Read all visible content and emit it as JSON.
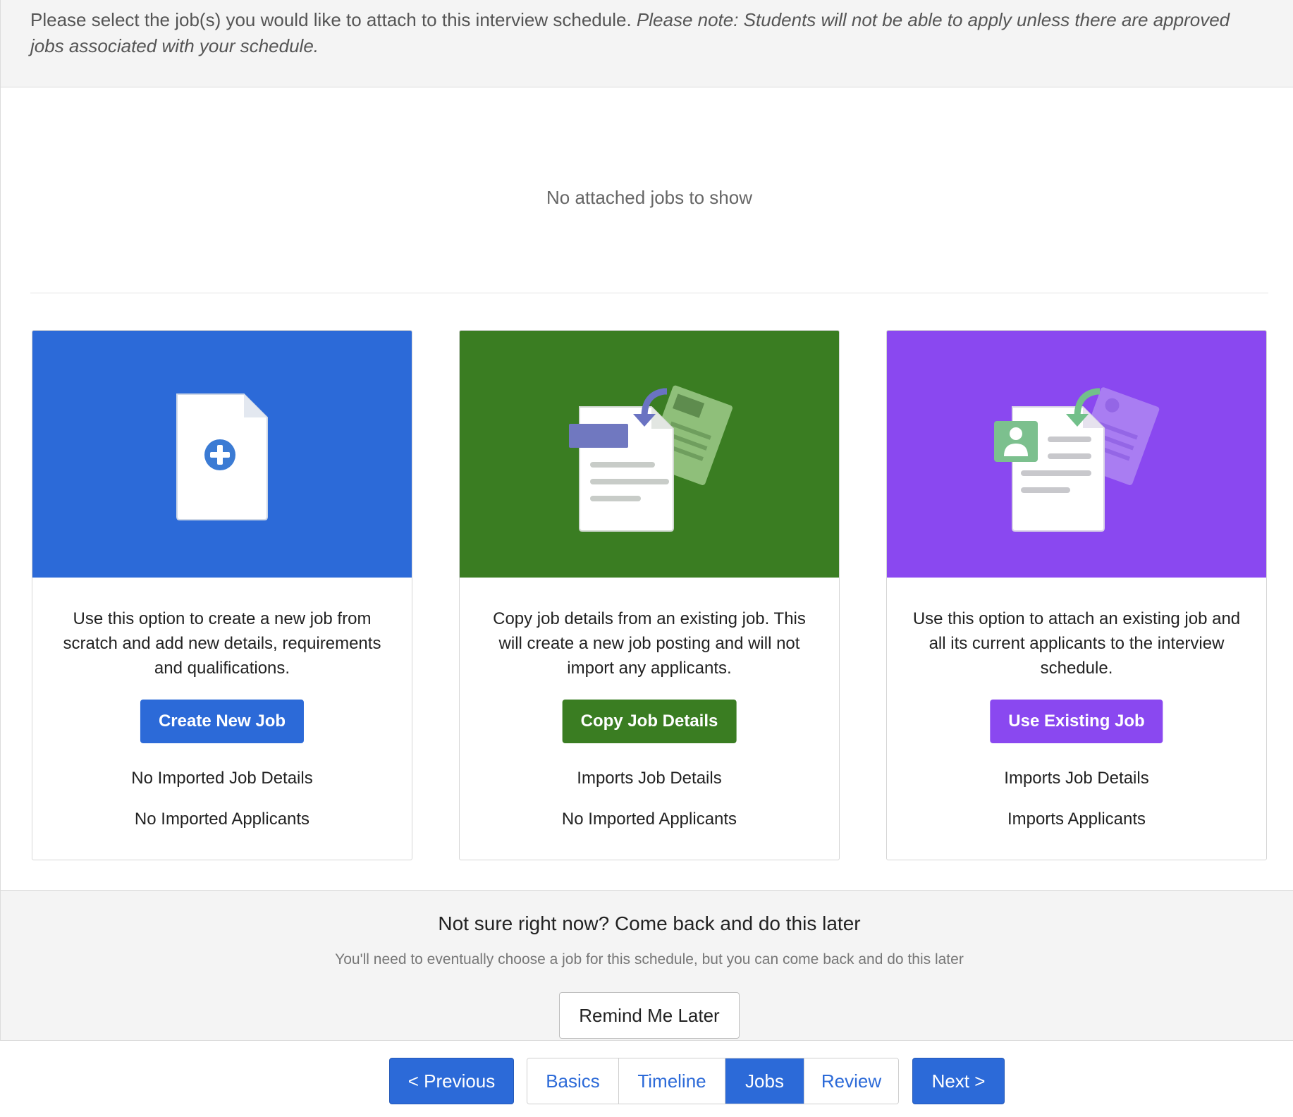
{
  "instructions": {
    "text": "Please select the job(s) you would like to attach to this interview schedule. ",
    "note": "Please note: Students will not be able to apply unless there are approved jobs associated with your schedule."
  },
  "attached_jobs": {
    "empty_message": "No attached jobs to show"
  },
  "options": [
    {
      "description": "Use this option to create a new job from scratch and add new details, requirements and qualifications.",
      "button_label": "Create New Job",
      "job_details": "No Imported Job Details",
      "applicants": "No Imported Applicants",
      "color": "#2c6ad8",
      "icon": "new-document-plus-icon"
    },
    {
      "description": "Copy job details from an existing job. This will create a new job posting and will not import any applicants.",
      "button_label": "Copy Job Details",
      "job_details": "Imports Job Details",
      "applicants": "No Imported Applicants",
      "color": "#3a7d22",
      "icon": "copy-document-icon"
    },
    {
      "description": "Use this option to attach an existing job and all its current applicants to the interview schedule.",
      "button_label": "Use Existing Job",
      "job_details": "Imports Job Details",
      "applicants": "Imports Applicants",
      "color": "#8a48f0",
      "icon": "existing-document-applicant-icon"
    }
  ],
  "later": {
    "title": "Not sure right now? Come back and do this later",
    "subtitle": "You'll need to eventually choose a job for this schedule, but you can come back and do this later",
    "button_label": "Remind Me Later"
  },
  "pager": {
    "previous_label": "< Previous",
    "next_label": "Next >",
    "steps": [
      "Basics",
      "Timeline",
      "Jobs",
      "Review"
    ],
    "active_step": "Jobs"
  }
}
